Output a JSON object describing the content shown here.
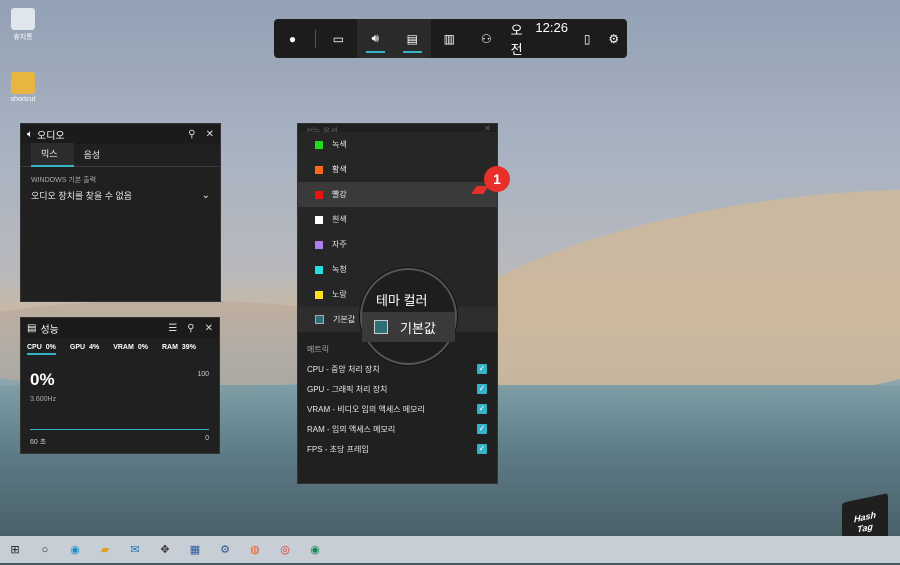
{
  "gamebar": {
    "time_ampm": "오전",
    "time_clock": "12:26"
  },
  "audio": {
    "title": "오디오",
    "tabs": [
      "믹스",
      "음성"
    ],
    "section_label": "WINDOWS 기본 출력",
    "device_text": "오디오 장치를 찾을 수 없음"
  },
  "performance": {
    "title": "성능",
    "stats": [
      {
        "label": "CPU",
        "value": "0%"
      },
      {
        "label": "GPU",
        "value": "4%"
      },
      {
        "label": "VRAM",
        "value": "0%"
      },
      {
        "label": "RAM",
        "value": "39%"
      }
    ],
    "big_value": "0%",
    "freq": "3.600Hz",
    "max_label": "100",
    "min_label": "0",
    "time_label": "60 초"
  },
  "perf_options": {
    "title_partial": "성능 옵션",
    "colors": [
      {
        "label": "녹색",
        "color": "#22dd22"
      },
      {
        "label": "황색",
        "color": "#ff6a1a"
      },
      {
        "label": "빨강",
        "color": "#ee1111"
      },
      {
        "label": "흰색",
        "color": "#ffffff"
      },
      {
        "label": "자주",
        "color": "#b07ee8"
      },
      {
        "label": "녹청",
        "color": "#22e0e0"
      },
      {
        "label": "노랑",
        "color": "#ffe020"
      },
      {
        "label": "기본값",
        "color": "#2e6e78"
      }
    ],
    "metrics_label": "메트릭",
    "metrics": [
      "CPU - 중앙 처리 장치",
      "GPU - 그래픽 처리 장치",
      "VRAM - 비디오 임의 액세스 메모리",
      "RAM - 임의 액세스 메모리",
      "FPS - 초당 프레임"
    ]
  },
  "callout": {
    "title": "테마 컬러",
    "item": "기본값",
    "swatch_color": "#2e6e78"
  },
  "step_badge": "1",
  "watermark": {
    "line1": "Hash",
    "line2": "Tag"
  },
  "desktop_icons": [
    "휴지통",
    "shortcut"
  ]
}
